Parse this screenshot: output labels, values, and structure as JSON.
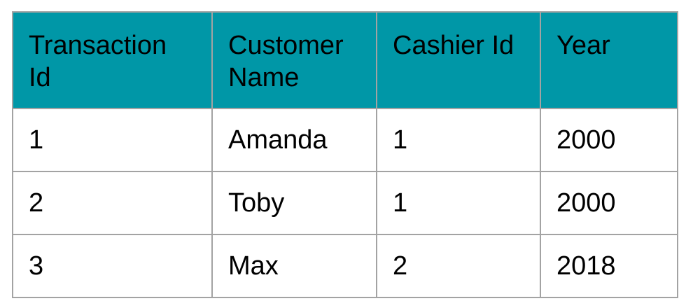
{
  "table": {
    "header_color": "#0097a7",
    "columns": [
      "Transaction Id",
      "Customer Name",
      "Cashier Id",
      "Year"
    ],
    "rows": [
      [
        "1",
        "Amanda",
        "1",
        "2000"
      ],
      [
        "2",
        "Toby",
        "1",
        "2000"
      ],
      [
        "3",
        "Max",
        "2",
        "2018"
      ]
    ]
  }
}
